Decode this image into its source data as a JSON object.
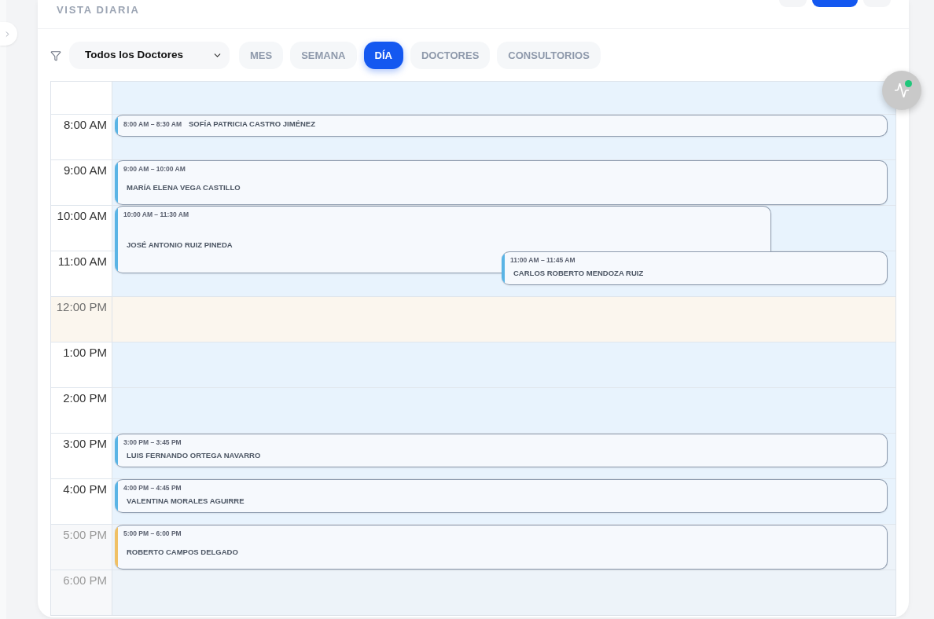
{
  "header": {
    "title": "VISTA DIARIA",
    "buttons": [
      {
        "kind": "secondary"
      },
      {
        "kind": "primary"
      },
      {
        "kind": "secondary"
      }
    ]
  },
  "toolbar": {
    "doctor_filter": {
      "value": "Todos los Doctores"
    },
    "views": [
      {
        "label": "MES",
        "selected": false
      },
      {
        "label": "SEMANA",
        "selected": false
      },
      {
        "label": "DÍA",
        "selected": true
      },
      {
        "label": "DOCTORES",
        "selected": false
      },
      {
        "label": "CONSULTORIOS",
        "selected": false
      }
    ]
  },
  "calendar": {
    "hours": [
      {
        "label": "8:00 AM",
        "kind": "work",
        "events": [
          {
            "time": "8:00 AM – 8:30 AM",
            "name": "SOFÍA PATRICIA CASTRO JIMÉNEZ",
            "kind": "half-hour",
            "color": "#5ab4e5"
          }
        ]
      },
      {
        "label": "9:00 AM",
        "kind": "work",
        "events": [
          {
            "time": "9:00 AM – 10:00 AM",
            "name": "MARÍA ELENA VEGA CASTILLO",
            "kind": "hour",
            "color": "#5ab4e5"
          }
        ]
      },
      {
        "label": "10:00 AM",
        "kind": "work",
        "events": [
          {
            "time": "10:00 AM – 11:30 AM",
            "name": "JOSÉ ANTONIO RUIZ PINEDA",
            "kind": "hour-and-half",
            "color": "#5ab4e5"
          }
        ]
      },
      {
        "label": "11:00 AM",
        "kind": "work",
        "events": [
          {
            "time": "11:00 AM – 11:45 AM",
            "name": "CARLOS ROBERTO MENDOZA RUIZ",
            "kind": "three-quarter-hour",
            "color": "#5ab4e5"
          }
        ]
      },
      {
        "label": "12:00 PM",
        "kind": "break"
      },
      {
        "label": "1:00 PM",
        "kind": "work"
      },
      {
        "label": "2:00 PM",
        "kind": "work"
      },
      {
        "label": "3:00 PM",
        "kind": "work",
        "events": [
          {
            "time": "3:00 PM – 3:45 PM",
            "name": "LUIS FERNANDO ORTEGA NAVARRO",
            "kind": "three-quarter-hour",
            "color": "#5ab4e5"
          }
        ]
      },
      {
        "label": "4:00 PM",
        "kind": "work",
        "events": [
          {
            "time": "4:00 PM – 4:45 PM",
            "name": "VALENTINA MORALES AGUIRRE",
            "kind": "three-quarter-hour",
            "color": "#5ab4e5"
          }
        ]
      },
      {
        "label": "5:00 PM",
        "kind": "closed",
        "events": [
          {
            "time": "5:00 PM – 6:00 PM",
            "name": "ROBERTO CAMPOS DELGADO",
            "kind": "hour",
            "color": "#f0c064"
          }
        ]
      },
      {
        "label": "6:00 PM",
        "kind": "closed"
      }
    ]
  }
}
